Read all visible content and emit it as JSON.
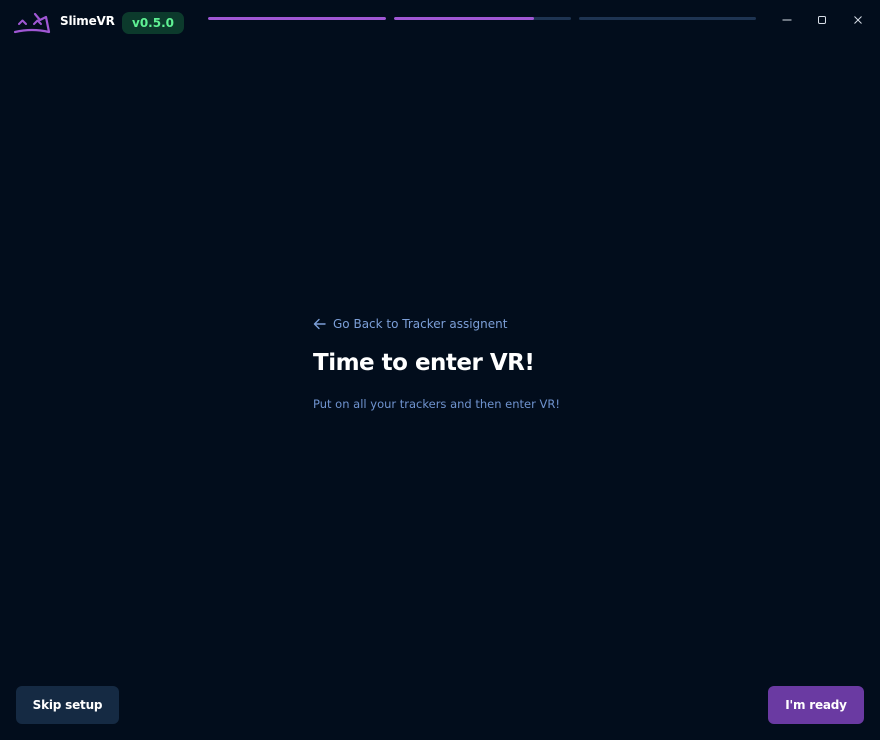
{
  "app": {
    "name": "SlimeVR",
    "version": "v0.5.0",
    "logo_icon": "slimevr-logo-icon",
    "accent_color": "#a057d4",
    "version_color": "#5ff294"
  },
  "progress": {
    "steps": [
      {
        "fill": 1.0
      },
      {
        "fill": 0.79
      },
      {
        "fill": 0.0
      }
    ]
  },
  "window_controls": {
    "minimize_icon": "minimize-icon",
    "maximize_icon": "maximize-icon",
    "close_icon": "close-icon"
  },
  "main": {
    "back_link": "Go Back to Tracker assignent",
    "title": "Time to enter VR!",
    "description": "Put on all your trackers and then enter VR!"
  },
  "footer": {
    "skip_label": "Skip setup",
    "ready_label": "I'm ready"
  }
}
